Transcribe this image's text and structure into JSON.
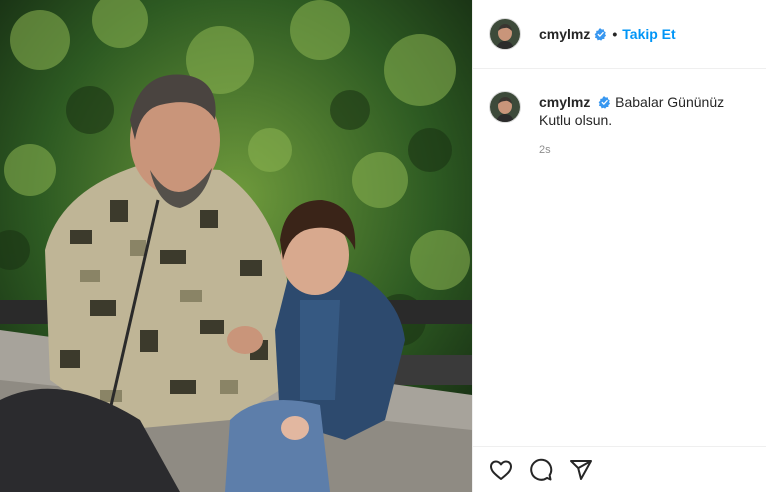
{
  "post": {
    "username": "cmylmz",
    "separator": "•",
    "follow_label": "Takip Et",
    "caption": "Babalar Gününüz Kutlu olsun.",
    "timestamp": "2s",
    "verified_icon": "verified-badge-icon",
    "action_icons": [
      "heart-icon",
      "comment-icon",
      "share-icon"
    ],
    "colors": {
      "accent": "#0095f6",
      "text": "#262626",
      "muted": "#8e8e8e",
      "border": "#efefef"
    }
  }
}
